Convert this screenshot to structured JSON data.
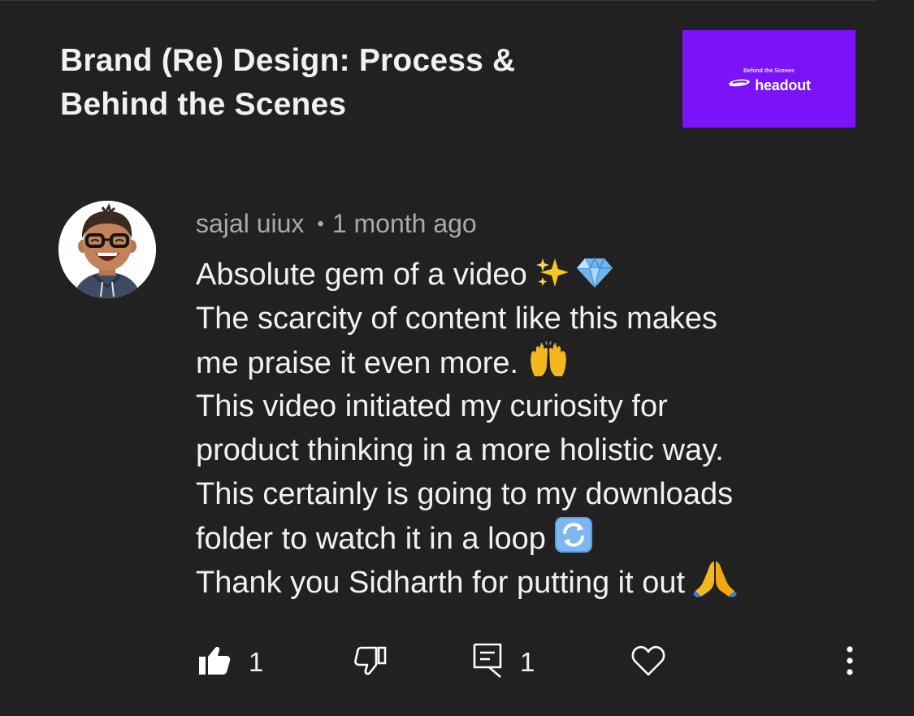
{
  "video": {
    "title": "Brand (Re) Design: Process & Behind the Scenes",
    "thumbnail": {
      "caption": "Behind the Scenes",
      "brand": "headout",
      "background": "#7a13f7",
      "icon": "headout-logo-icon"
    }
  },
  "comment": {
    "author": "sajal uiux",
    "separator": "•",
    "time": "1 month ago",
    "avatar_icon": "memoji-avatar",
    "lines": [
      {
        "text": "Absolute gem of a video",
        "emojis": [
          "sparkles-emoji",
          "gem-emoji"
        ]
      },
      {
        "text": "The scarcity of content like this makes",
        "emojis": []
      },
      {
        "text": "me praise it even more.",
        "emojis": [
          "raising-hands-emoji"
        ]
      },
      {
        "text": "This video initiated my curiosity for",
        "emojis": []
      },
      {
        "text": "product thinking in a more holistic way.",
        "emojis": []
      },
      {
        "text": "This certainly is going to my downloads",
        "emojis": []
      },
      {
        "text": "folder to watch it in a loop",
        "emojis": [
          "loop-arrows-emoji"
        ]
      },
      {
        "text": "Thank you Sidharth for putting it out",
        "emojis": [
          "folded-hands-emoji"
        ]
      }
    ]
  },
  "actions": {
    "like": {
      "icon": "thumbs-up-filled-icon",
      "count": "1"
    },
    "dislike": {
      "icon": "thumbs-down-outline-icon"
    },
    "reply": {
      "icon": "comment-icon",
      "count": "1"
    },
    "heart": {
      "icon": "heart-outline-icon"
    },
    "more": {
      "icon": "more-vertical-icon"
    }
  },
  "colors": {
    "background": "#212121",
    "primary_text": "#f1f1f1",
    "secondary_text": "#aaaaaa",
    "thumbnail_bg": "#7a13f7"
  }
}
